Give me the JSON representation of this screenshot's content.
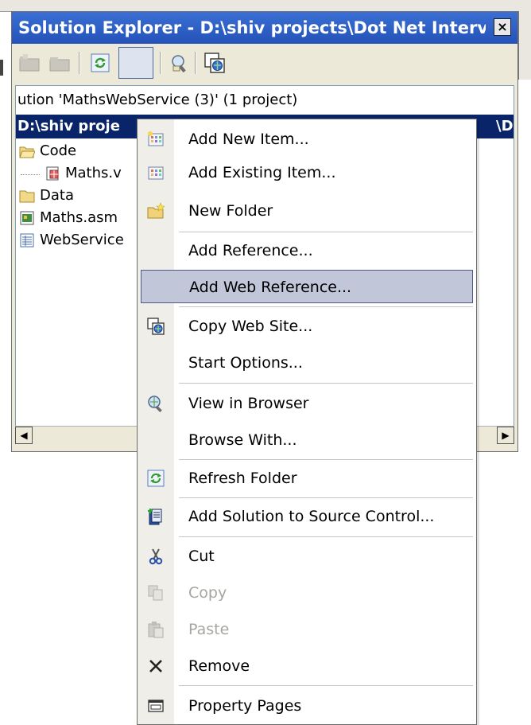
{
  "window": {
    "title": "Solution Explorer - D:\\shiv projects\\Dot Net Intervi...",
    "close_glyph": "×"
  },
  "toolbar": {
    "buttons": [
      "show-all-files-icon",
      "nest-files-icon",
      "refresh-icon",
      "selected-button",
      "copy-web-site-icon",
      "asp-net-config-icon"
    ]
  },
  "tree": {
    "solution_label": "ution 'MathsWebService (3)' (1 project)",
    "project_label": "D:\\shiv proje",
    "project_label_right": "\\Dis",
    "items": [
      {
        "label": "Code",
        "icon": "folder-open-icon"
      },
      {
        "label": "Maths.v",
        "icon": "class-file-icon"
      },
      {
        "label": "Data",
        "icon": "folder-icon"
      },
      {
        "label": "Maths.asm",
        "icon": "asmx-file-icon"
      },
      {
        "label": "WebService",
        "icon": "config-file-icon"
      }
    ]
  },
  "context_menu": {
    "items": [
      {
        "label": "Add New Item...",
        "icon": "add-new-item-icon",
        "disabled": false
      },
      {
        "label": "Add Existing Item...",
        "icon": "add-existing-item-icon",
        "disabled": false
      },
      {
        "label": "New Folder",
        "icon": "new-folder-icon",
        "disabled": false
      },
      {
        "label": "Add Reference...",
        "icon": "",
        "disabled": false
      },
      {
        "label": "Add Web Reference...",
        "icon": "",
        "disabled": false,
        "highlighted": true
      },
      {
        "label": "Copy Web Site...",
        "icon": "copy-web-site-icon",
        "disabled": false
      },
      {
        "label": "Start Options...",
        "icon": "",
        "disabled": false
      },
      {
        "label": "View in Browser",
        "icon": "view-in-browser-icon",
        "disabled": false
      },
      {
        "label": "Browse With...",
        "icon": "",
        "disabled": false
      },
      {
        "label": "Refresh Folder",
        "icon": "refresh-folder-icon",
        "disabled": false
      },
      {
        "label": "Add Solution to Source Control...",
        "icon": "source-control-icon",
        "disabled": false
      },
      {
        "label": "Cut",
        "icon": "scissors-icon",
        "disabled": false
      },
      {
        "label": "Copy",
        "icon": "copy-icon",
        "disabled": true
      },
      {
        "label": "Paste",
        "icon": "paste-icon",
        "disabled": true
      },
      {
        "label": "Remove",
        "icon": "remove-icon",
        "disabled": false
      },
      {
        "label": "Property Pages",
        "icon": "property-pages-icon",
        "disabled": false
      }
    ]
  },
  "colors": {
    "title_bar": "#2452b8",
    "selection": "#0a246a",
    "menu_highlight": "#c1c6d8",
    "menu_gutter": "#efeee9"
  }
}
